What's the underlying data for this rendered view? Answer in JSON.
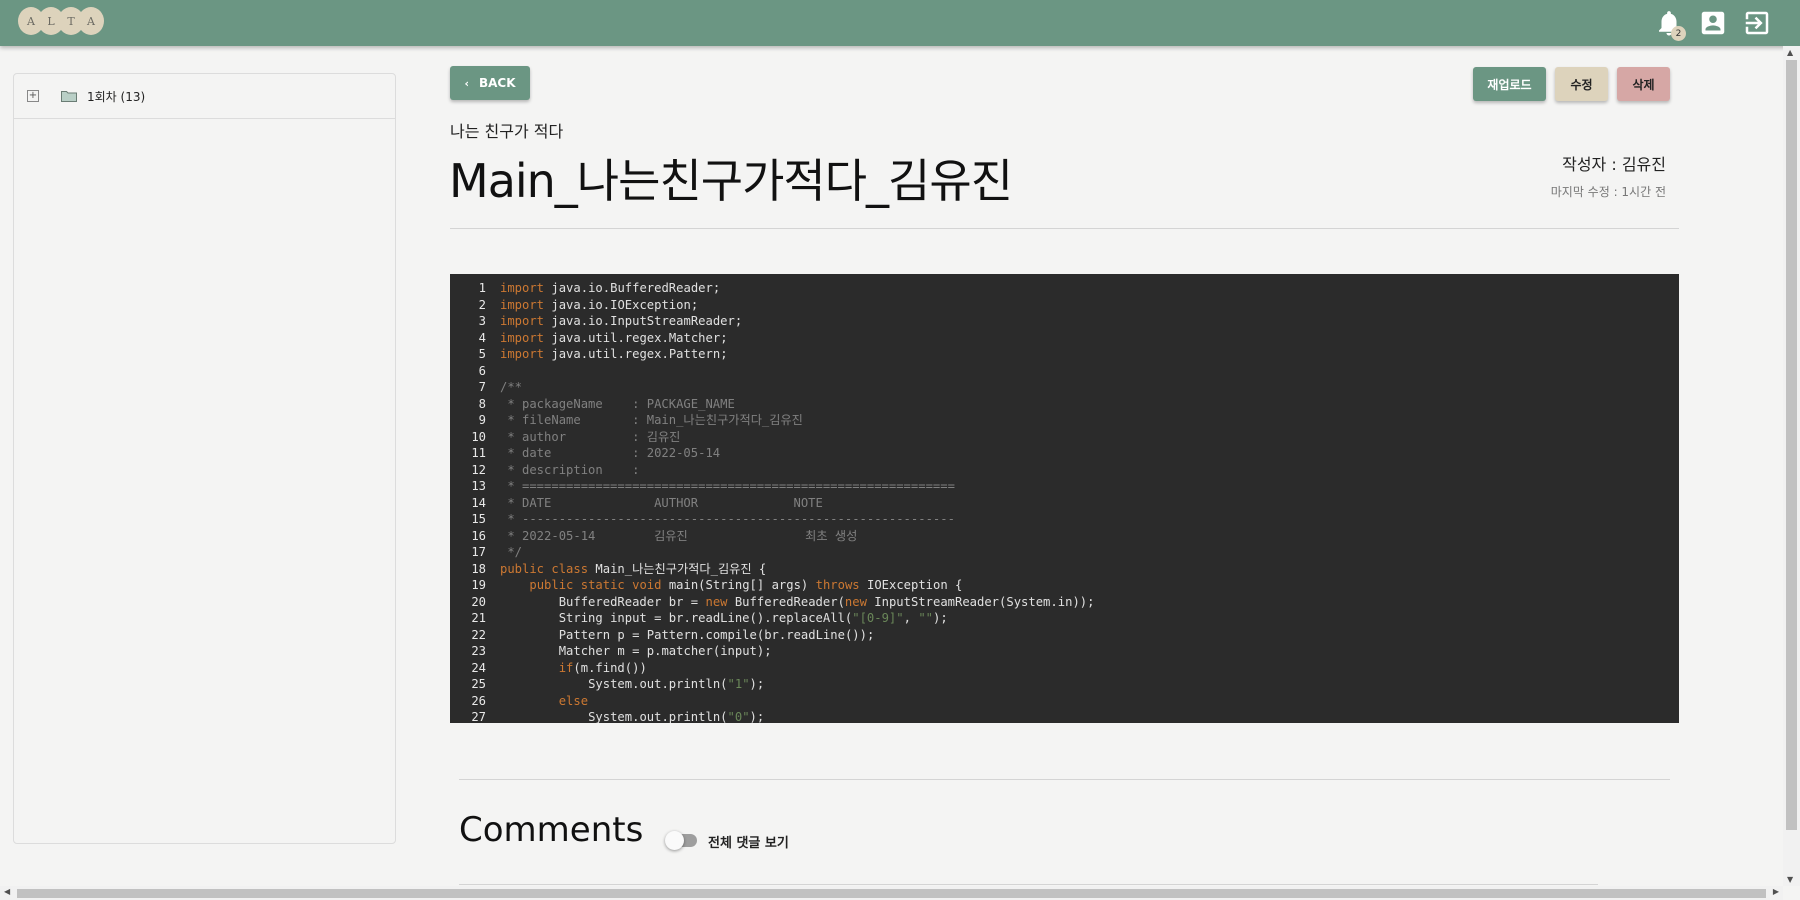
{
  "header": {
    "logo_letters": [
      "A",
      "L",
      "T",
      "A"
    ],
    "notification_count": "2",
    "icons": [
      "bell-icon",
      "account-icon",
      "logout-icon"
    ],
    "accent_color": "#6b9683"
  },
  "sidebar": {
    "items": [
      {
        "expander": "+",
        "label": "1회차 (13)",
        "icon": "folder-icon"
      }
    ]
  },
  "actions": {
    "back_label": "BACK",
    "reupload_label": "재업로드",
    "edit_label": "수정",
    "delete_label": "삭제"
  },
  "document": {
    "subtitle": "나는 친구가 적다",
    "title": "Main_나는친구가적다_김유진",
    "author": "작성자 : 김유진",
    "last_modified": "마지막 수정 : 1시간 전"
  },
  "code": {
    "language": "java",
    "lines": [
      "import java.io.BufferedReader;",
      "import java.io.IOException;",
      "import java.io.InputStreamReader;",
      "import java.util.regex.Matcher;",
      "import java.util.regex.Pattern;",
      "",
      "/**",
      " * packageName    : PACKAGE_NAME",
      " * fileName       : Main_나는친구가적다_김유진",
      " * author         : 김유진",
      " * date           : 2022-05-14",
      " * description    :",
      " * ===========================================================",
      " * DATE              AUTHOR             NOTE",
      " * -----------------------------------------------------------",
      " * 2022-05-14        김유진                최초 생성",
      " */",
      "public class Main_나는친구가적다_김유진 {",
      "    public static void main(String[] args) throws IOException {",
      "        BufferedReader br = new BufferedReader(new InputStreamReader(System.in));",
      "        String input = br.readLine().replaceAll(\"[0-9]\", \"\");",
      "        Pattern p = Pattern.compile(br.readLine());",
      "        Matcher m = p.matcher(input);",
      "        if(m.find())",
      "            System.out.println(\"1\");",
      "        else",
      "            System.out.println(\"0\");"
    ]
  },
  "comments": {
    "title": "Comments",
    "toggle_label": "전체 댓글 보기",
    "toggle_on": false
  }
}
